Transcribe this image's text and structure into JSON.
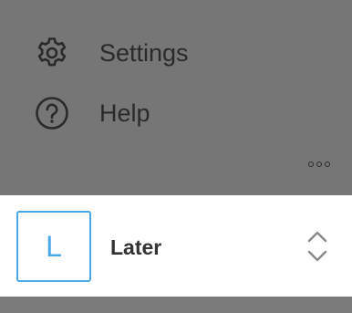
{
  "menu": {
    "items": [
      {
        "label": "Settings",
        "icon": "gear-icon"
      },
      {
        "label": "Help",
        "icon": "help-circle-icon"
      }
    ],
    "more_icon": "more-horizontal-icon"
  },
  "workspace": {
    "avatar_letter": "L",
    "name": "Later",
    "switcher_icon": "chevron-up-down-icon"
  },
  "colors": {
    "overlay": "#767676",
    "accent": "#4ba9e8",
    "text": "#2a2a2a",
    "panel": "#ffffff"
  }
}
